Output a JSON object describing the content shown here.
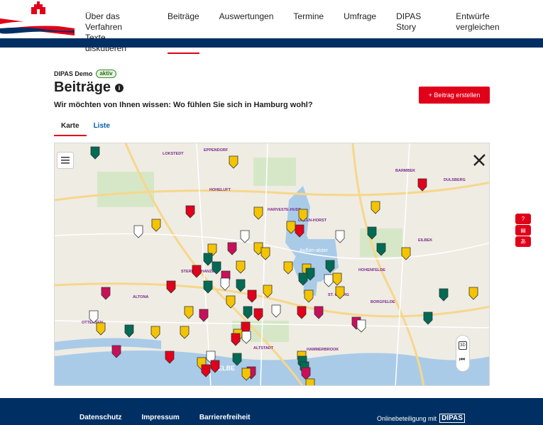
{
  "nav": {
    "items": [
      {
        "label_line1": "Über das Verfahren",
        "label_line2": "Texte diskutieren",
        "active": false
      },
      {
        "label_line1": "Beiträge",
        "label_line2": "",
        "active": true
      },
      {
        "label_line1": "Auswertungen",
        "label_line2": "",
        "active": false
      },
      {
        "label_line1": "Termine",
        "label_line2": "",
        "active": false
      },
      {
        "label_line1": "Umfrage",
        "label_line2": "",
        "active": false
      },
      {
        "label_line1": "DIPAS Story",
        "label_line2": "",
        "active": false
      },
      {
        "label_line1": "Entwürfe vergleichen",
        "label_line2": "",
        "active": false
      }
    ]
  },
  "page": {
    "project": "DIPAS Demo",
    "status": "aktiv",
    "title": "Beiträge",
    "subtitle": "Wir möchten von Ihnen wissen: Wo fühlen Sie sich in Hamburg wohl?",
    "create_button": "+ Beitrag erstellen"
  },
  "tabs": [
    {
      "label": "Karte",
      "active": true
    },
    {
      "label": "Liste",
      "active": false
    }
  ],
  "map": {
    "labels": [
      "EPPENDORF",
      "LOKSTEDT",
      "HOHELUFT",
      "HARVESTE-HUDE",
      "UHLEN-HORST",
      "BARMBEK",
      "DULSBERG",
      "EILBEK",
      "HOHENFELDE",
      "ST. GEORG",
      "BORGFELDE",
      "ALTONA",
      "STERN-SCHANZE",
      "ALTSTADT",
      "HAMMERBROOK",
      "ELBE",
      "OTTENSEN",
      "Außen-alster"
    ],
    "buttons": {
      "view_3d": "3D"
    },
    "colors": {
      "yellow": "#f5c400",
      "red": "#e2001a",
      "green": "#006b54",
      "magenta": "#c8105a",
      "white": "#ffffff"
    }
  },
  "footer": {
    "links": [
      "Datenschutz",
      "Impressum",
      "Barrierefreiheit"
    ],
    "powered_by": "Onlinebeteiligung mit",
    "brand": "DIPAS"
  },
  "side_tools": [
    "help-icon",
    "chat-icon",
    "translate-icon"
  ]
}
